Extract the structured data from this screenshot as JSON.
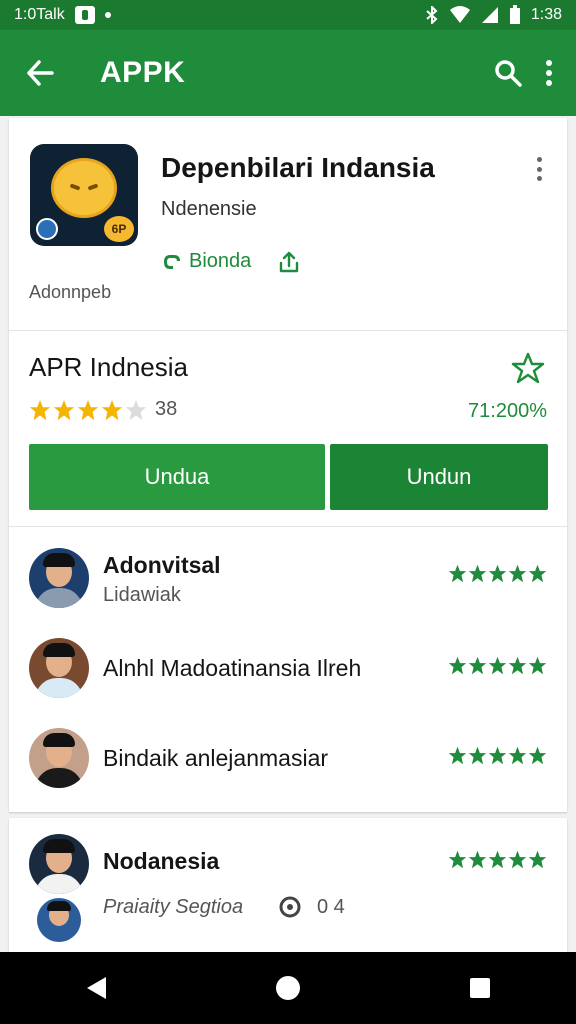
{
  "status_bar": {
    "time_left": "1:0Talk",
    "time_right": "1:38"
  },
  "app_bar": {
    "title": "APPK",
    "icons": [
      "back-arrow-icon",
      "search-icon",
      "more-vert-icon"
    ]
  },
  "app_header": {
    "name": "Depenbilari Indansia",
    "subtitle": "Ndenensie",
    "link_label": "Bionda",
    "developer": "Adonnpeb"
  },
  "rating_section": {
    "title": "APR Indnesia",
    "stars": 4,
    "count": "38",
    "percent": "71:200%",
    "button_primary": "Undua",
    "button_secondary": "Undun"
  },
  "reviews": [
    {
      "name": "Adonvitsal",
      "sub": "Lidawiak",
      "stars": 5
    },
    {
      "name": "Alnhl Madoatinansia Ilreh",
      "sub": "",
      "stars": 5
    },
    {
      "name": "Bindaik anlejanmasiar",
      "sub": "",
      "stars": 5
    },
    {
      "name": "Nodanesia",
      "sub": "Praiaity Segtioa",
      "extra": "0 4",
      "stars": 5
    }
  ],
  "colors": {
    "status_bar": "#1c7a30",
    "app_bar": "#1e8c3a",
    "accent_green": "#1e8c3a",
    "star_gold": "#f4b400"
  }
}
